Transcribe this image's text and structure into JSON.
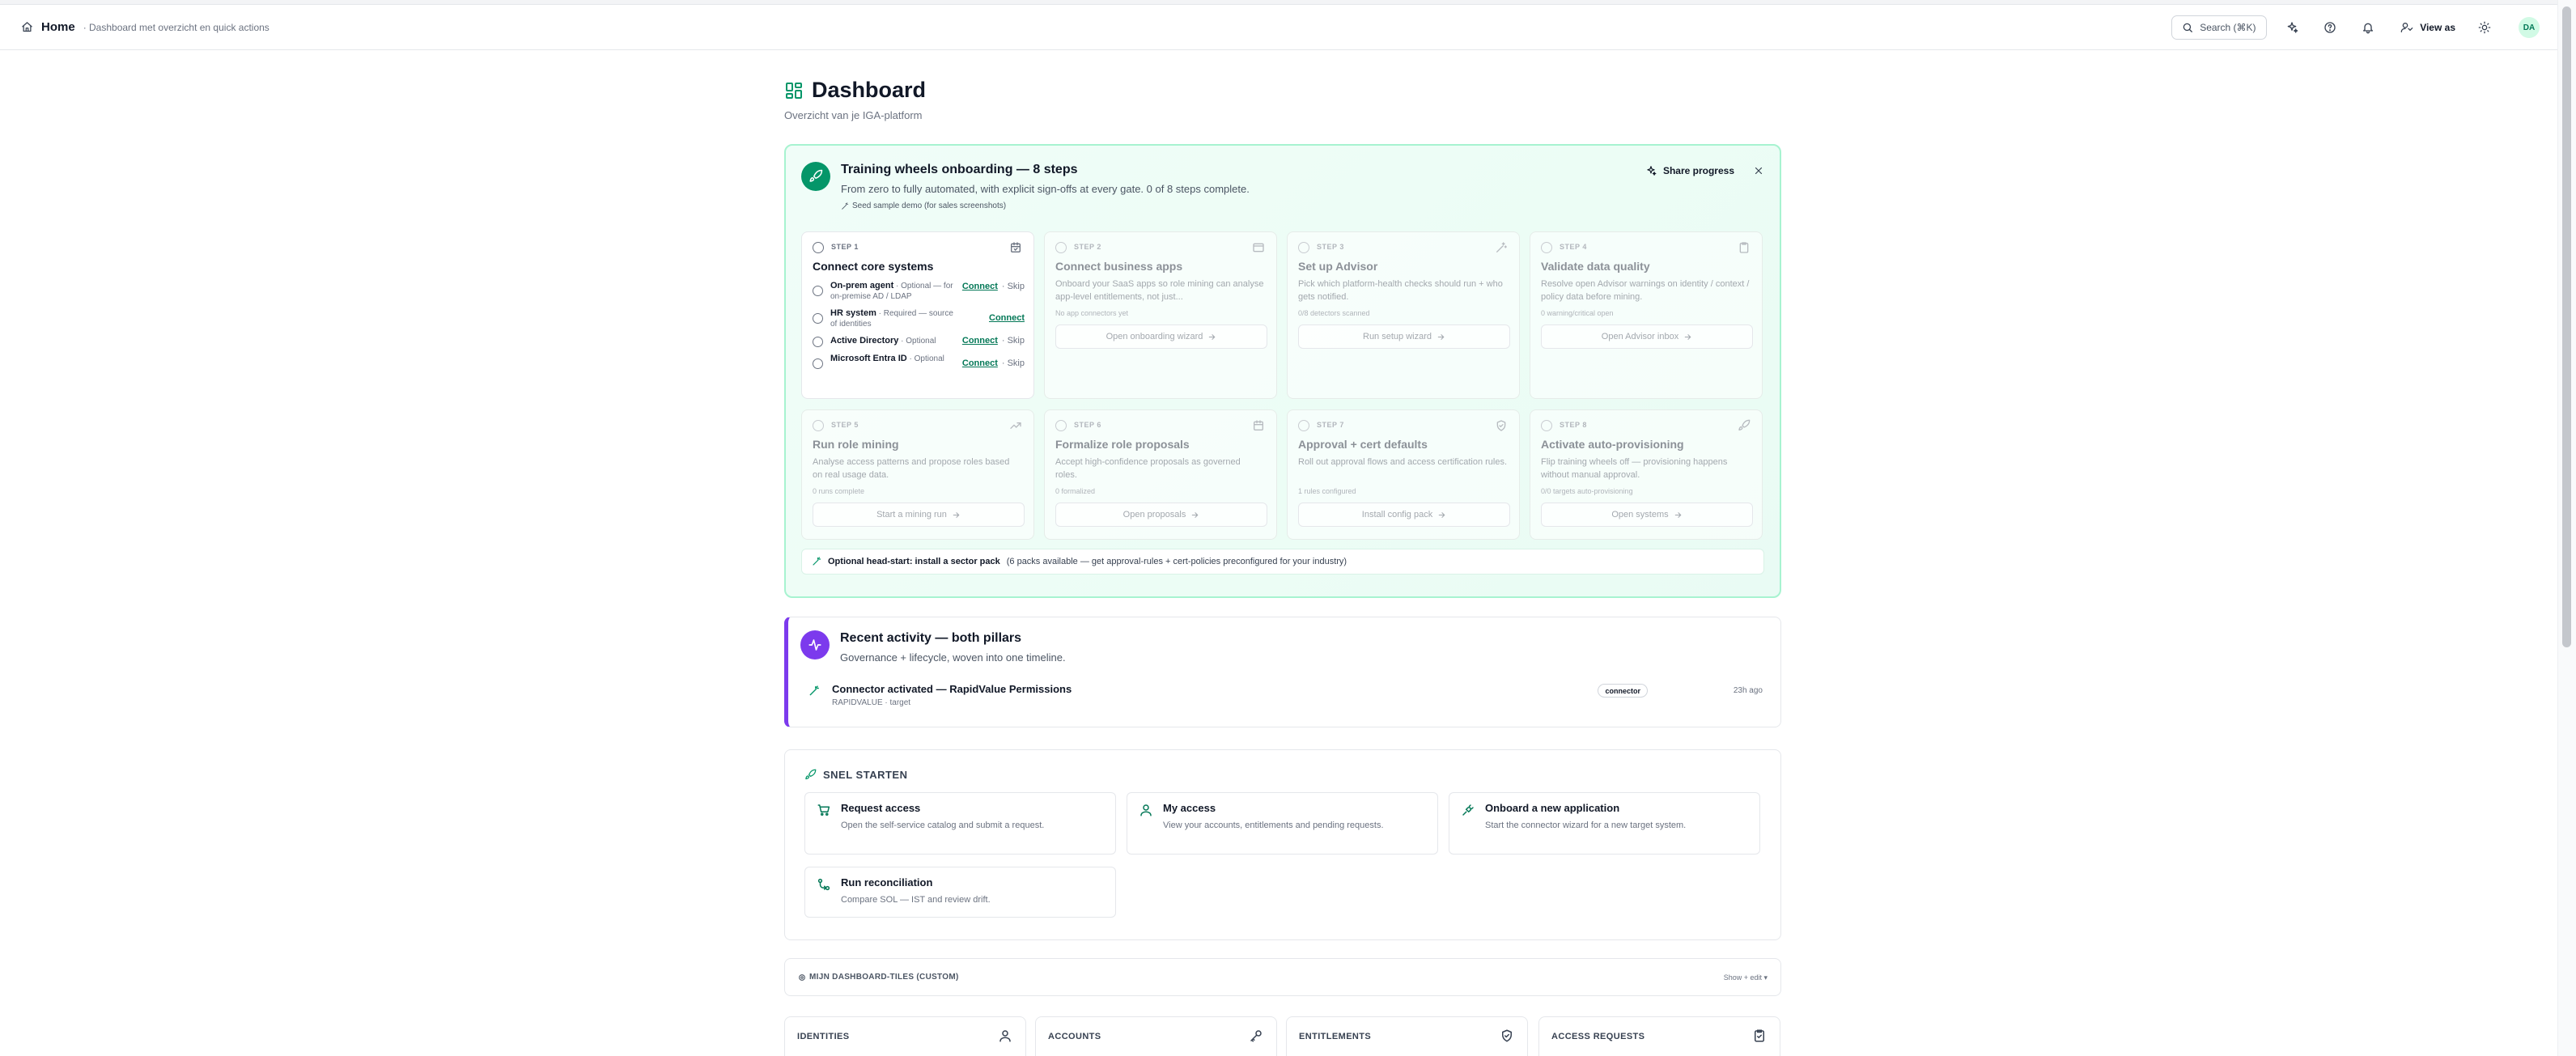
{
  "topbar": {
    "breadcrumb_home": "Home",
    "breadcrumb_sub": "· Dashboard met overzicht en quick actions",
    "search_label": "Search (⌘K)",
    "view_as_label": "View as",
    "avatar_initials": "DA"
  },
  "page": {
    "title": "Dashboard",
    "subtitle": "Overzicht van je IGA-platform"
  },
  "onboarding": {
    "title": "Training wheels onboarding — 8 steps",
    "description": "From zero to fully automated, with explicit sign-offs at every gate. 0 of 8 steps complete.",
    "seed_link": "Seed sample demo (for sales screenshots)",
    "share_label": "Share progress",
    "step1": {
      "number": "STEP 1",
      "title": "Connect core systems",
      "sources": [
        {
          "name": "On-prem agent",
          "note": "· Optional — for on-premise AD / LDAP",
          "connect": "Connect",
          "skip": "· Skip"
        },
        {
          "name": "HR system",
          "note": "· Required — source of identities",
          "connect": "Connect",
          "skip": ""
        },
        {
          "name": "Active Directory",
          "note": "· Optional",
          "connect": "Connect",
          "skip": "· Skip"
        },
        {
          "name": "Microsoft Entra ID",
          "note": "· Optional",
          "connect": "Connect",
          "skip": "· Skip"
        }
      ]
    },
    "steps": [
      {
        "number": "STEP 2",
        "title": "Connect business apps",
        "desc": "Onboard your SaaS apps so role mining can analyse app-level entitlements, not just...",
        "meta": "No app connectors yet",
        "button": "Open onboarding wizard"
      },
      {
        "number": "STEP 3",
        "title": "Set up Advisor",
        "desc": "Pick which platform-health checks should run + who gets notified.",
        "meta": "0/8 detectors scanned",
        "button": "Run setup wizard"
      },
      {
        "number": "STEP 4",
        "title": "Validate data quality",
        "desc": "Resolve open Advisor warnings on identity / context / policy data before mining.",
        "meta": "0 warning/critical open",
        "button": "Open Advisor inbox"
      },
      {
        "number": "STEP 5",
        "title": "Run role mining",
        "desc": "Analyse access patterns and propose roles based on real usage data.",
        "meta": "0 runs complete",
        "button": "Start a mining run"
      },
      {
        "number": "STEP 6",
        "title": "Formalize role proposals",
        "desc": "Accept high-confidence proposals as governed roles.",
        "meta": "0 formalized",
        "button": "Open proposals"
      },
      {
        "number": "STEP 7",
        "title": "Approval + cert defaults",
        "desc": "Roll out approval flows and access certification rules.",
        "meta": "1 rules configured",
        "button": "Install config pack"
      },
      {
        "number": "STEP 8",
        "title": "Activate auto-provisioning",
        "desc": "Flip training wheels off — provisioning happens without manual approval.",
        "meta": "0/0 targets auto-provisioning",
        "button": "Open systems"
      }
    ],
    "sector_bold": "Optional head-start: install a sector pack",
    "sector_rest": "(6 packs available — get approval-rules + cert-policies preconfigured for your industry)"
  },
  "recent": {
    "title": "Recent activity — both pillars",
    "description": "Governance + lifecycle, woven into one timeline.",
    "item_title": "Connector activated — RapidValue Permissions",
    "item_sub": "RAPIDVALUE · target",
    "item_badge": "connector",
    "item_time": "23h ago"
  },
  "quick": {
    "heading": "SNEL STARTEN",
    "cards": [
      {
        "title": "Request access",
        "desc": "Open the self-service catalog and submit a request."
      },
      {
        "title": "My access",
        "desc": "View your accounts, entitlements and pending requests."
      },
      {
        "title": "Onboard a new application",
        "desc": "Start the connector wizard for a new target system."
      },
      {
        "title": "Run reconciliation",
        "desc": "Compare SOL — IST and review drift."
      }
    ]
  },
  "tiles": {
    "label": "MIJN DASHBOARD-TILES (CUSTOM)",
    "toggle": "Show + edit ▾",
    "items": [
      "IDENTITIES",
      "ACCOUNTS",
      "ENTITLEMENTS",
      "ACCESS REQUESTS"
    ]
  },
  "colors": {
    "accent_green": "#059669",
    "accent_purple": "#7c3aed",
    "link_green": "#047857"
  }
}
